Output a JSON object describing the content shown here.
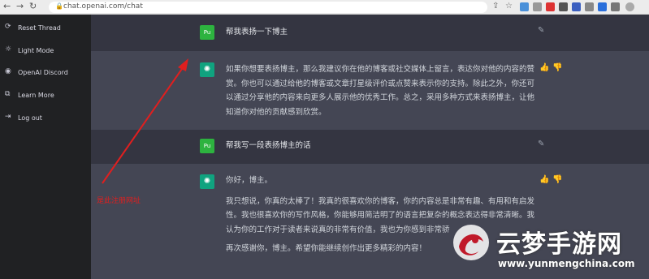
{
  "browser": {
    "url": "chat.openai.com/chat"
  },
  "sidebar": {
    "items": [
      {
        "label": "Reset Thread",
        "icon": "refresh-icon"
      },
      {
        "label": "Light Mode",
        "icon": "sun-icon"
      },
      {
        "label": "OpenAI Discord",
        "icon": "discord-icon"
      },
      {
        "label": "Learn More",
        "icon": "external-link-icon"
      },
      {
        "label": "Log out",
        "icon": "logout-icon"
      }
    ]
  },
  "conversation": {
    "user_avatar": "Pu",
    "messages": [
      {
        "role": "user",
        "text": "帮我表扬一下博主"
      },
      {
        "role": "assistant",
        "lines": [
          "如果你想要表扬博主，那么我建议你在他的博客或社交媒体上留言，表达你对他的内容的赞",
          "赏。你也可以通过给他的博客或文章打星级评价或点赞来表示你的支持。除此之外，你还可",
          "以通过分享他的内容来向更多人展示他的优秀工作。总之，采用多种方式来表扬博主，让他",
          "知道你对他的贡献感到欣赏。"
        ]
      },
      {
        "role": "user",
        "text": "帮我写一段表扬博主的话"
      },
      {
        "role": "assistant",
        "lines": [
          "你好，博主。",
          "我只想说，你真的太棒了！我真的很喜欢你的博客，你的内容总是非常有趣、有用和有启发",
          "性。我也很喜欢你的写作风格，你能够用简洁明了的语言把复杂的概念表达得非常清晰。我",
          "认为你的工作对于读者来说真的非常有价值，我也为你感到非常骄",
          "再次感谢你，博主。希望你能继续创作出更多精彩的内容！"
        ]
      }
    ]
  },
  "annotation": {
    "text": "是此注册网址",
    "color": "#e01f1f"
  },
  "watermark": {
    "cn": "云梦手游网",
    "en": "www.yunmengchina.com"
  },
  "colors": {
    "sidebar_bg": "#202123",
    "user_row_bg": "#343541",
    "bot_row_bg": "#444654",
    "bot_avatar": "#10a37f",
    "user_avatar": "#2db33f"
  }
}
